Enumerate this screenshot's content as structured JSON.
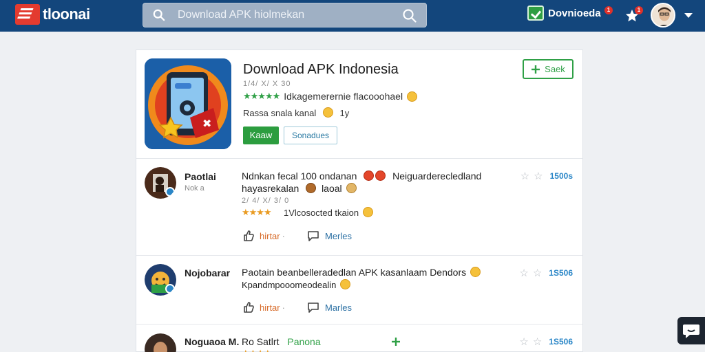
{
  "header": {
    "brand": "tloonai",
    "search_placeholder": "Download APK hiolmekan",
    "download_label": "Dovnioeda",
    "download_badge": "1",
    "star_badge": "1"
  },
  "app": {
    "title": "Download APK Indonesia",
    "subtitle": "1/4/ X/ X 30",
    "rating_text": "Idkagemerernie flacooohael",
    "desc": "Rassa snala kanal",
    "desc_suffix": "1y",
    "install_label": "Kaaw",
    "more_label": "Sonadues",
    "save_label": "Saek"
  },
  "reviews": [
    {
      "name": "Paotlai",
      "meta": "Nok a",
      "text_line1": "Ndnkan fecal 100 ondanan",
      "text_line1_suffix": "Neiguarderecledland",
      "text_line2": "hayasrekalan",
      "text_line2_suffix": "laoal",
      "small": "2/ 4/ X/ 3/ 0",
      "rating_text": "1Vlcosocted tkaion",
      "like_label": "hirtar",
      "reply_label": "Merles",
      "score": "1500s"
    },
    {
      "name": "Nojobarar",
      "meta": "",
      "text_line1": "Paotain beanbelleradedlan APK kasanlaam Dendors",
      "text_line2": "Kpandmpooomeodealin",
      "like_label": "hirtar",
      "reply_label": "Marles",
      "score": "1S506"
    },
    {
      "name": "Noguaoa M.",
      "text_line1": "Ro Satlrt",
      "text_line1_suffix": "Panona",
      "score": "1S506"
    }
  ],
  "colors": {
    "topbar": "#13467c",
    "accent_green": "#2fa046",
    "link_blue": "#2a86c7"
  }
}
